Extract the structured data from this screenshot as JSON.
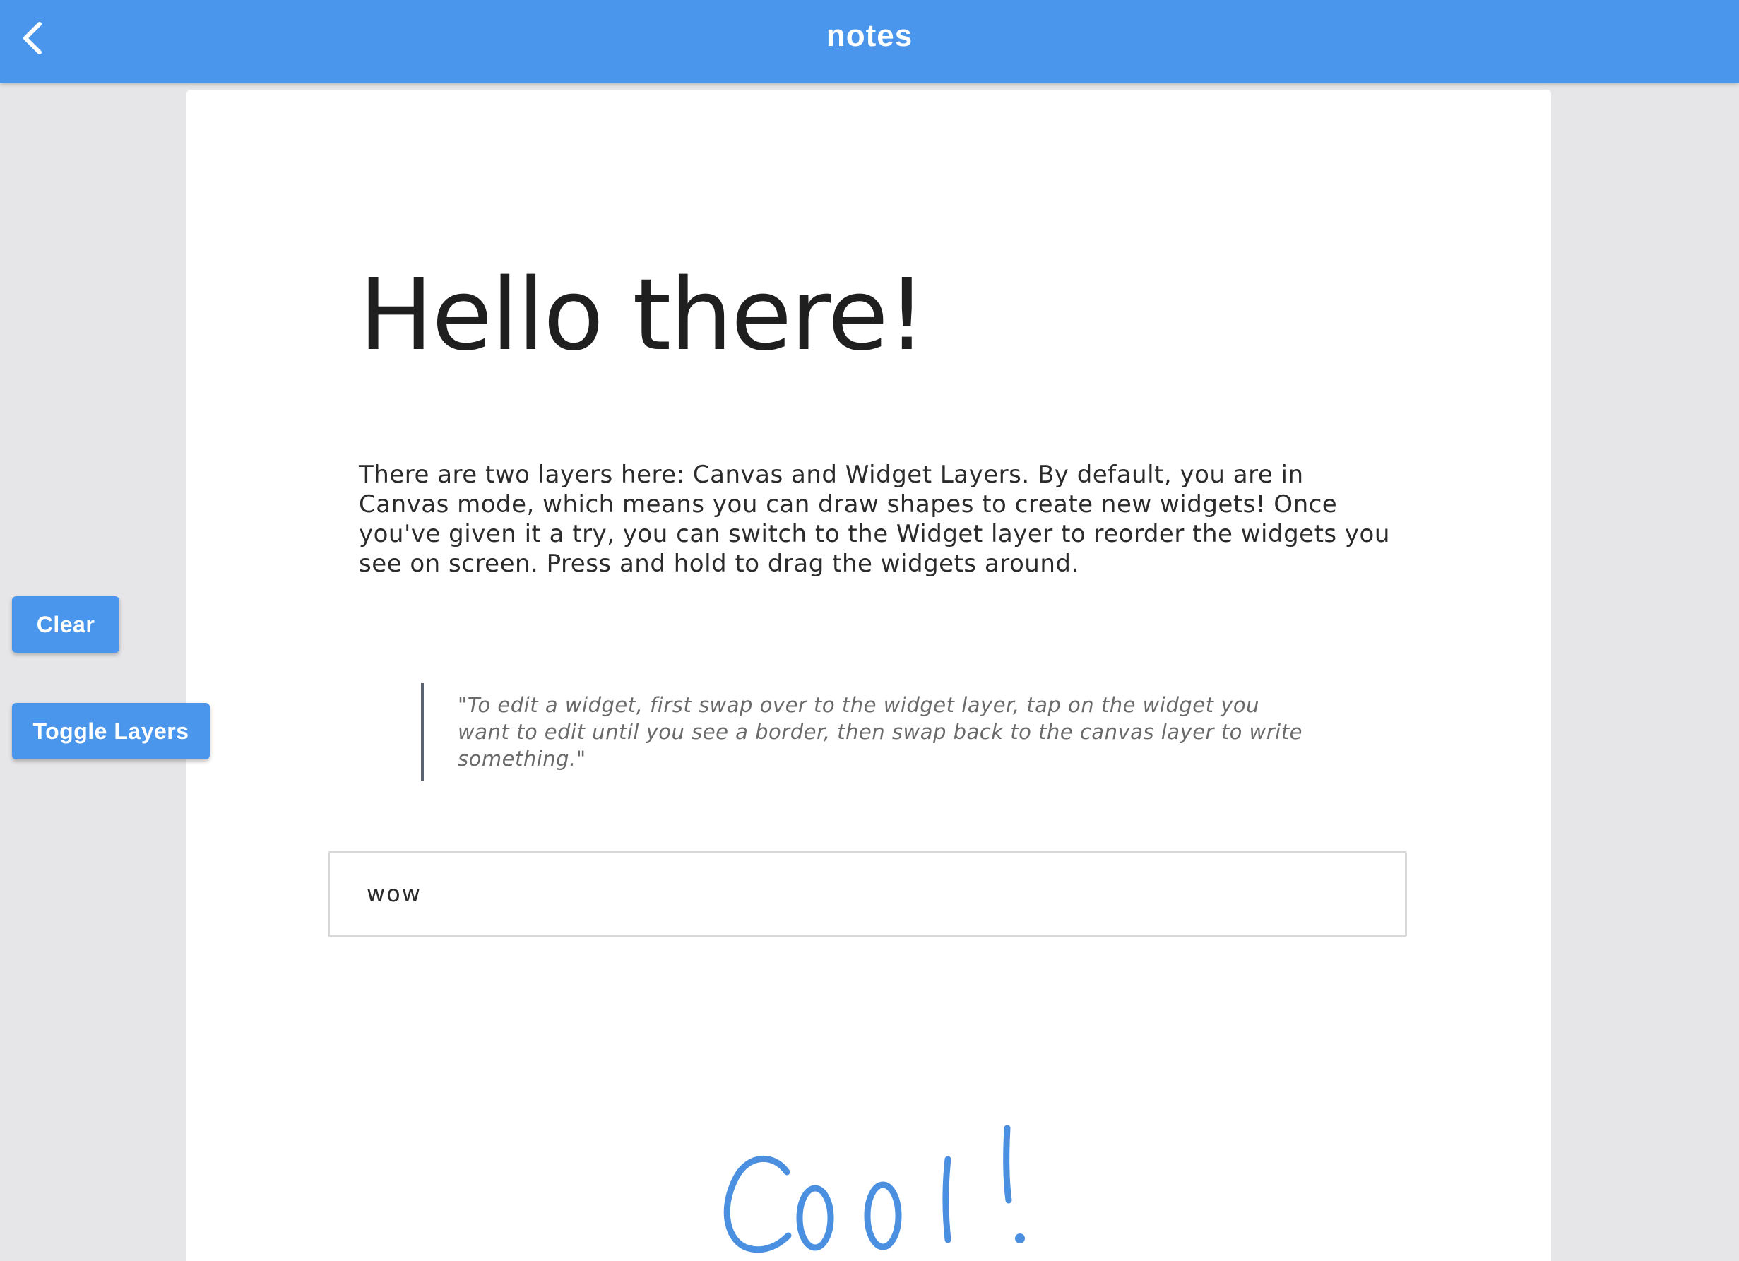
{
  "app_bar": {
    "title": "notes",
    "back_icon": "chevron-left-icon",
    "color": "#4a96ec"
  },
  "controls": {
    "clear_label": "Clear",
    "toggle_label": "Toggle Layers"
  },
  "page": {
    "heading": "Hello there!",
    "body": "There are two layers here: Canvas and Widget Layers. By default, you are in Canvas mode, which means you can draw shapes to create new widgets! Once you've given it a try, you can switch to the Widget layer to reorder the widgets you see on screen. Press and hold to drag the widgets around.",
    "quote": "\"To edit a widget, first swap over to the widget layer, tap on the widget you want to edit until you see a border, then swap back to the canvas layer to write something.\"",
    "text_field_value": "wow",
    "handwriting": "Cool!",
    "handwriting_color": "#4a8fe0"
  }
}
